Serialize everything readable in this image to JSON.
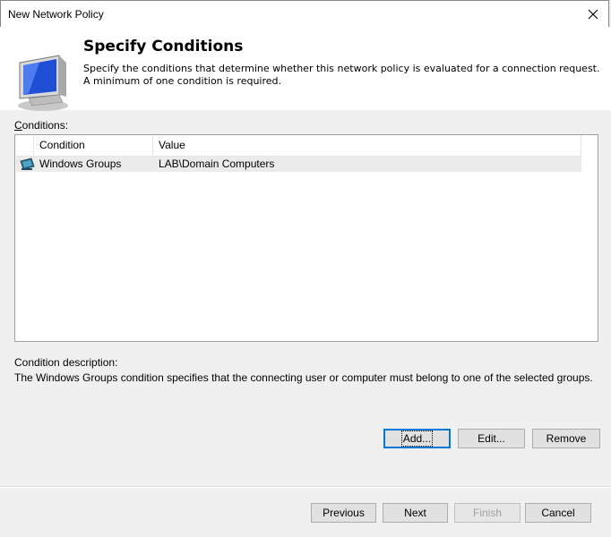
{
  "window": {
    "title": "New Network Policy"
  },
  "header": {
    "title": "Specify Conditions",
    "description": "Specify the conditions that determine whether this network policy is evaluated for a connection request. A minimum of one condition is required."
  },
  "conditions": {
    "label_first": "C",
    "label_rest": "onditions:",
    "columns": [
      "Condition",
      "Value"
    ],
    "rows": [
      {
        "icon": "group-icon",
        "condition": "Windows Groups",
        "value": "LAB\\Domain Computers"
      }
    ]
  },
  "description": {
    "label": "Condition description:",
    "text": "The Windows Groups condition specifies that the connecting user or computer must belong to one of the selected groups."
  },
  "buttons": {
    "add": "Add...",
    "edit": "Edit...",
    "remove": "Remove",
    "previous": "Previous",
    "next": "Next",
    "finish": "Finish",
    "cancel": "Cancel"
  },
  "colors": {
    "accent": "#0078d7",
    "selection": "#ebebeb"
  }
}
